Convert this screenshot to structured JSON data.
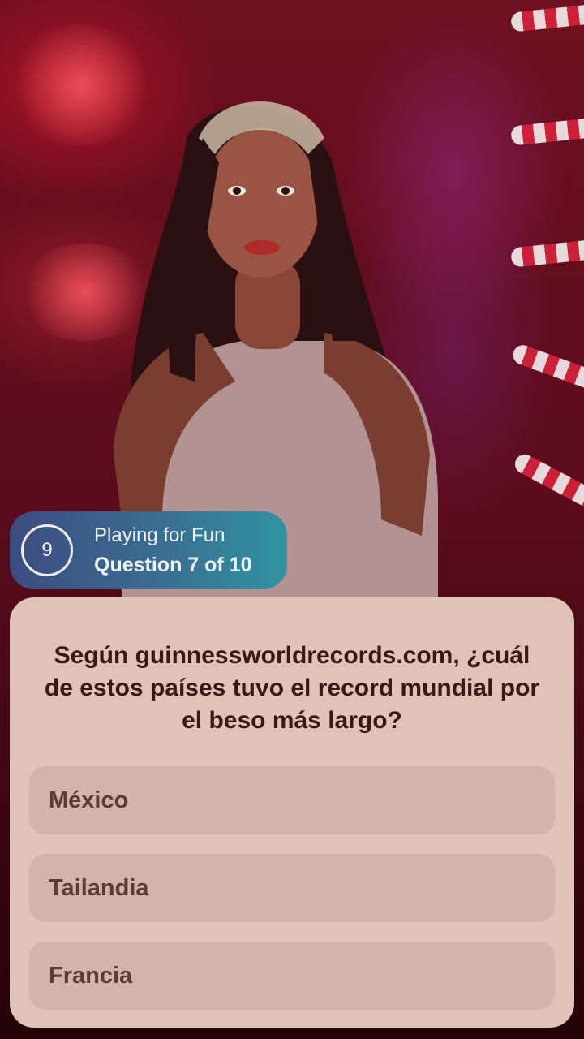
{
  "status": {
    "timer_value": "9",
    "mode_label": "Playing for Fun",
    "progress_label": "Question 7 of 10"
  },
  "question": {
    "text": "Según guinnessworldrecords.com, ¿cuál de estos países tuvo el record mundial por el beso más largo?"
  },
  "options": [
    {
      "label": "México"
    },
    {
      "label": "Tailandia"
    },
    {
      "label": "Francia"
    }
  ],
  "colors": {
    "card_background": "#dfc2b8",
    "option_background": "#d1b4ac",
    "question_text": "#3a1818",
    "pill_gradient_start": "#3c4c80",
    "pill_gradient_end": "#2f94a0"
  }
}
